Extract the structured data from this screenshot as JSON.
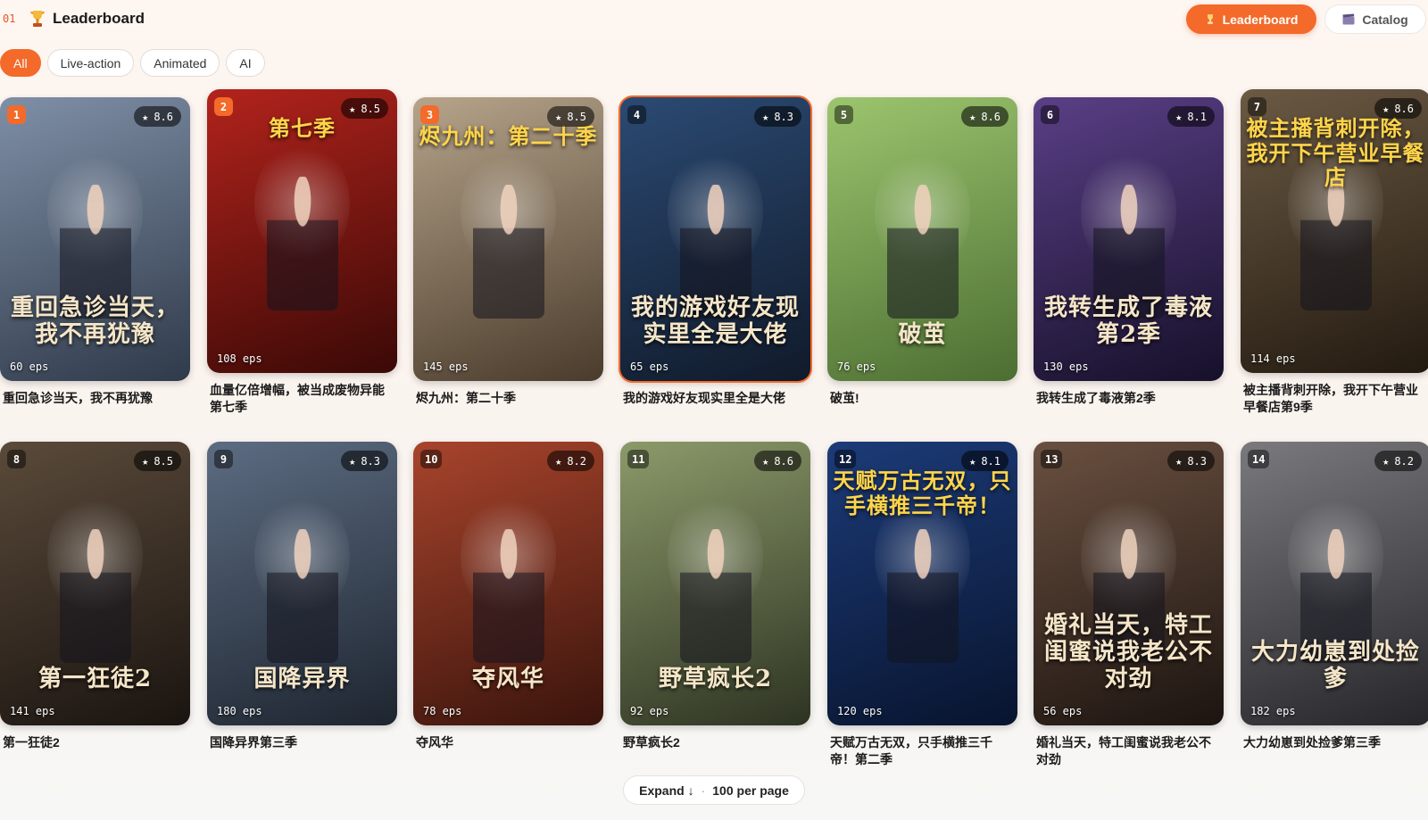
{
  "header": {
    "rank_code": "01",
    "title": "Leaderboard",
    "nav": [
      {
        "label": "Leaderboard",
        "icon": "trophy-icon"
      },
      {
        "label": "Catalog",
        "icon": "clapper-icon"
      }
    ]
  },
  "filters": [
    {
      "label": "All",
      "active": true
    },
    {
      "label": "Live-action",
      "active": false
    },
    {
      "label": "Animated",
      "active": false
    },
    {
      "label": "AI",
      "active": false
    }
  ],
  "cards": [
    {
      "rank": "1",
      "rating": "8.6",
      "eps": "60 eps",
      "name": "重回急诊当天，我不再犹豫",
      "poster_text": "重回急诊当天，我不再犹豫",
      "colors": [
        "#7f8fa6",
        "#2f3a4a"
      ]
    },
    {
      "rank": "2",
      "rating": "8.5",
      "eps": "108 eps",
      "name": "血量亿倍增幅，被当成废物异能第七季",
      "poster_text": "第七季",
      "colors": [
        "#b3231c",
        "#3a0906"
      ]
    },
    {
      "rank": "3",
      "rating": "8.5",
      "eps": "145 eps",
      "name": "烬九州：第二十季",
      "poster_text": "烬九州：第二十季",
      "colors": [
        "#b6a48a",
        "#4a3b2c"
      ]
    },
    {
      "rank": "4",
      "rating": "8.3",
      "eps": "65 eps",
      "name": "我的游戏好友现实里全是大佬",
      "poster_text": "我的游戏好友现实里全是大佬",
      "colors": [
        "#2b4a73",
        "#101a2a"
      ]
    },
    {
      "rank": "5",
      "rating": "8.6",
      "eps": "76 eps",
      "name": "破茧!",
      "poster_text": "破茧",
      "colors": [
        "#9cc56e",
        "#4c6e32"
      ]
    },
    {
      "rank": "6",
      "rating": "8.1",
      "eps": "130 eps",
      "name": "我转生成了毒液第2季",
      "poster_text": "我转生成了毒液第2季",
      "colors": [
        "#5a3f86",
        "#16102a"
      ]
    },
    {
      "rank": "7",
      "rating": "8.6",
      "eps": "114 eps",
      "name": "被主播背刺开除，我开下午营业早餐店第9季",
      "poster_text": "被主播背刺开除，我开下午营业早餐店",
      "colors": [
        "#6b5a44",
        "#231a10"
      ]
    },
    {
      "rank": "8",
      "rating": "8.5",
      "eps": "141 eps",
      "name": "第一狂徒2",
      "poster_text": "第一狂徒2",
      "colors": [
        "#5a4a3a",
        "#1a1410"
      ]
    },
    {
      "rank": "9",
      "rating": "8.3",
      "eps": "180 eps",
      "name": "国降异界第三季",
      "poster_text": "国降异界",
      "colors": [
        "#5c6c82",
        "#1e2530"
      ]
    },
    {
      "rank": "10",
      "rating": "8.2",
      "eps": "78 eps",
      "name": "夺风华",
      "poster_text": "夺风华",
      "colors": [
        "#a8442c",
        "#3a140c"
      ]
    },
    {
      "rank": "11",
      "rating": "8.6",
      "eps": "92 eps",
      "name": "野草疯长2",
      "poster_text": "野草疯长2",
      "colors": [
        "#8c9a6a",
        "#2d3322"
      ]
    },
    {
      "rank": "12",
      "rating": "8.1",
      "eps": "120 eps",
      "name": "天赋万古无双，只手横推三千帝！第二季",
      "poster_text": "天赋万古无双，只手横推三千帝！",
      "colors": [
        "#1c3b78",
        "#08142e"
      ]
    },
    {
      "rank": "13",
      "rating": "8.3",
      "eps": "56 eps",
      "name": "婚礼当天，特工闺蜜说我老公不对劲",
      "poster_text": "婚礼当天，特工闺蜜说我老公不对劲",
      "colors": [
        "#6a5040",
        "#1c1410"
      ]
    },
    {
      "rank": "14",
      "rating": "8.2",
      "eps": "182 eps",
      "name": "大力幼崽到处捡爹第三季",
      "poster_text": "大力幼崽到处捡爹",
      "colors": [
        "#7a7a7e",
        "#26262a"
      ]
    }
  ],
  "expand": {
    "label": "Expand ↓",
    "per_page": "100 per page"
  }
}
